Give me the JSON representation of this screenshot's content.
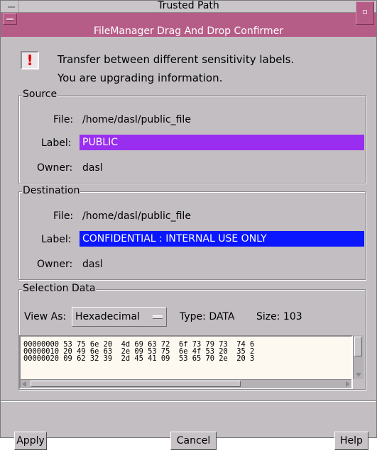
{
  "trusted_bar": {
    "title": "Trusted Path"
  },
  "window": {
    "title": "FileManager Drag And Drop Confirmer"
  },
  "message": {
    "icon": "warning-exclamation-icon",
    "line1": "Transfer between different sensitivity labels.",
    "line2": "You are upgrading information."
  },
  "source": {
    "group_title": "Source",
    "file_label": "File:",
    "file_value": "/home/dasl/public_file",
    "label_label": "Label:",
    "label_value": "PUBLIC",
    "label_color": "#9a2ef0",
    "owner_label": "Owner:",
    "owner_value": "dasl"
  },
  "destination": {
    "group_title": "Destination",
    "file_label": "File:",
    "file_value": "/home/dasl/public_file",
    "label_label": "Label:",
    "label_value": "CONFIDENTIAL : INTERNAL USE ONLY",
    "label_color": "#0a17ff",
    "owner_label": "Owner:",
    "owner_value": "dasl"
  },
  "selection": {
    "group_title": "Selection Data",
    "view_as_label": "View As:",
    "view_as_value": "Hexadecimal",
    "type_label": "Type: DATA",
    "size_label": "Size: 103",
    "hex_lines": [
      "00000000 53 75 6e 20  4d 69 63 72  6f 73 79 73  74 6",
      "00000010 20 49 6e 63  2e 09 53 75  6e 4f 53 20  35 2",
      "00000020 09 62 32 39  2d 45 41 09  53 65 70 2e  20 3"
    ]
  },
  "buttons": {
    "apply": "Apply",
    "cancel": "Cancel",
    "help": "Help"
  }
}
